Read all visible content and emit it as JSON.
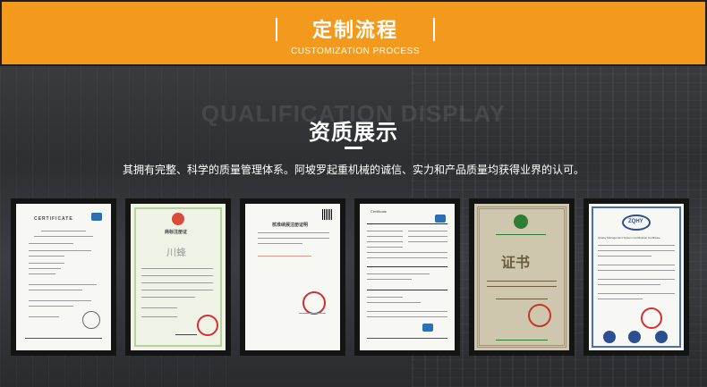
{
  "header": {
    "title": "定制流程",
    "subtitle": "CUSTOMIZATION PROCESS"
  },
  "section": {
    "ghost_text": "QUALIFICATION DISPLAY",
    "title": "资质展示",
    "description": "其拥有完整、科学的质量管理体系。阿坡罗起重机械的诚信、实力和产品质量均获得业界的认可。"
  },
  "certificates": {
    "c1": {
      "heading": "CERTIFICATE"
    },
    "c2": {
      "heading": "商标注册证",
      "name": "川蜂"
    },
    "c3": {
      "heading": "核准续展注册证明"
    },
    "c4": {
      "heading": "Certificate"
    },
    "c5": {
      "heading": "证书"
    },
    "c6": {
      "logo": "ZQHY",
      "heading": "Quality Management System Certification Certificate"
    }
  },
  "colors": {
    "accent": "#f39a1e",
    "seal": "#d32f2f",
    "green": "#2e7d32"
  }
}
